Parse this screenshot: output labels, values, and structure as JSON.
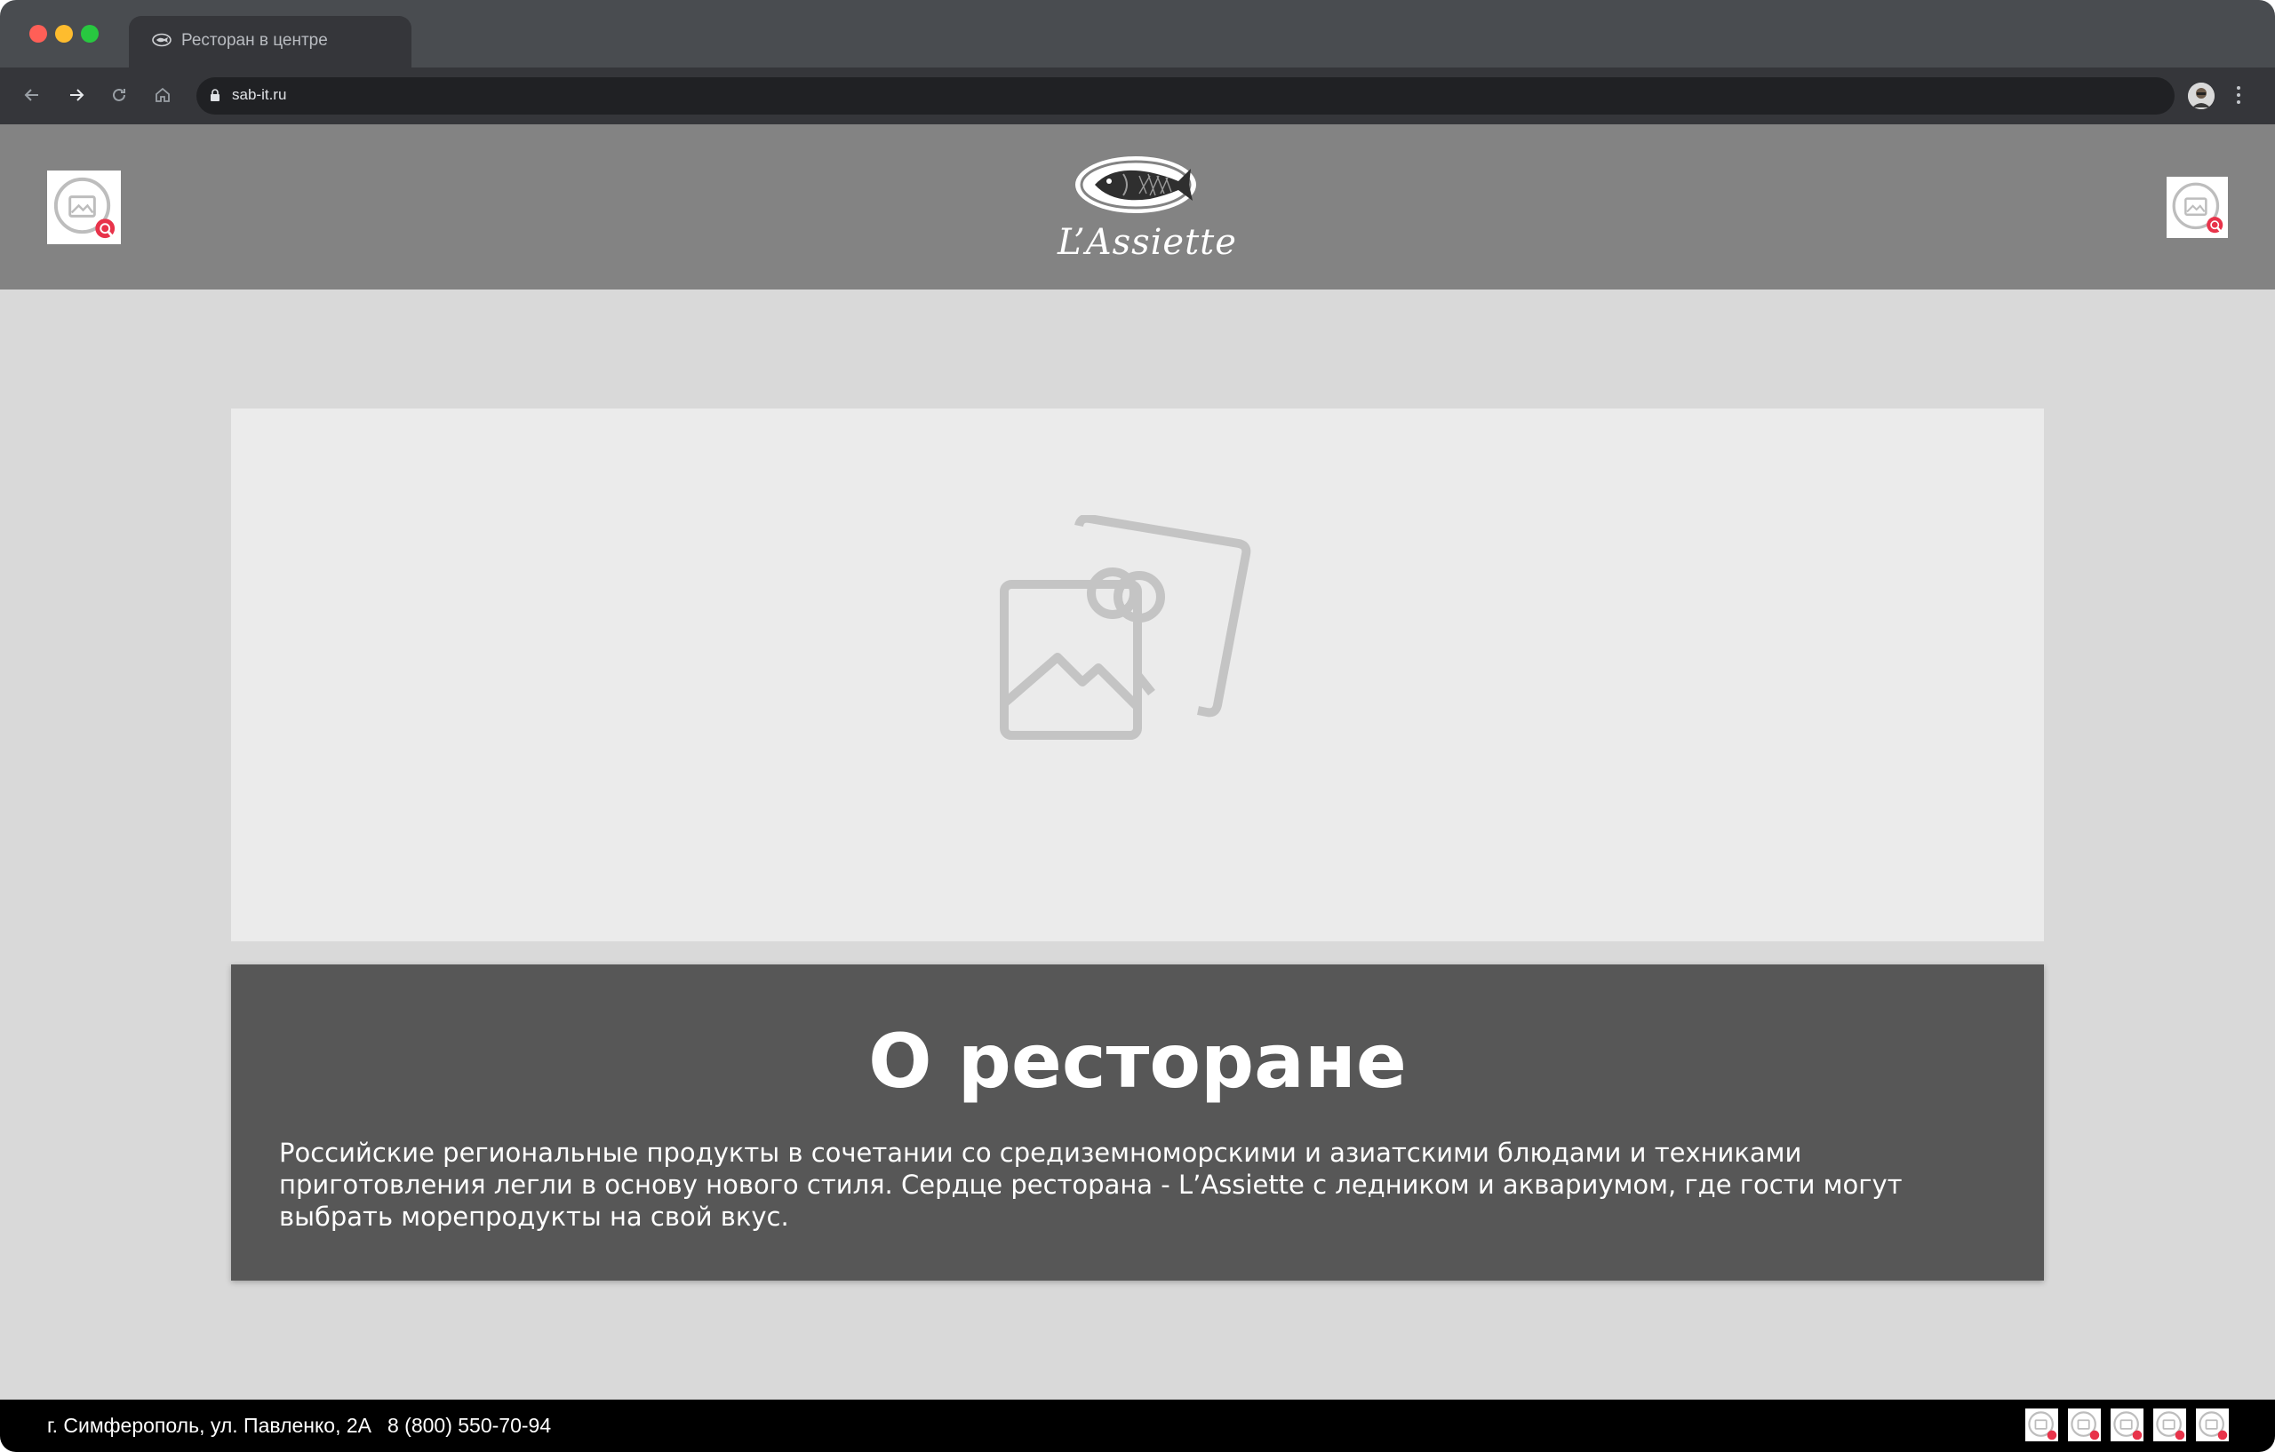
{
  "browser": {
    "tab_title": "Ресторан в центре",
    "url": "sab-it.ru",
    "icons": [
      "back-icon",
      "forward-icon",
      "reload-icon",
      "home-icon",
      "lock-icon",
      "profile-avatar",
      "menu-icon"
    ]
  },
  "header": {
    "logo_text": "L’Assiette",
    "left_image": "image-placeholder",
    "right_image": "image-placeholder"
  },
  "hero": {
    "image": "image-placeholder"
  },
  "about": {
    "title": "О ресторане",
    "text": "Российские региональные продукты в сочетании со средиземноморскими и азиатскими блюдами и техниками приготовления легли в основу нового стиля. Сердце ресторана - L’Assiette с ледником и аквариумом, где гости могут выбрать морепродукты на свой вкус."
  },
  "footer": {
    "address": "г. Симферополь, ул. Павленко, 2А",
    "phone": "8 (800) 550-70-94",
    "social_links": [
      "social-link-1",
      "social-link-2",
      "social-link-3",
      "social-link-4",
      "social-link-5"
    ]
  },
  "colors": {
    "header_bg": "#838383",
    "page_bg": "#d9d9d9",
    "card_bg": "#575757",
    "hero_bg": "#ebebeb",
    "footer_bg": "#000000"
  }
}
